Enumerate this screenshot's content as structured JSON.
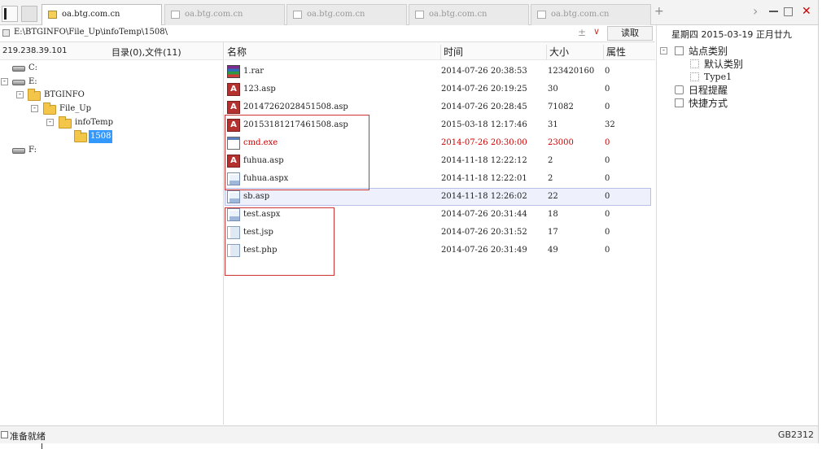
{
  "tabs": [
    {
      "label": "oa.btg.com.cn",
      "active": true
    },
    {
      "label": "oa.btg.com.cn",
      "active": false
    },
    {
      "label": "oa.btg.com.cn",
      "active": false
    },
    {
      "label": "oa.btg.com.cn",
      "active": false
    },
    {
      "label": "oa.btg.com.cn",
      "active": false
    }
  ],
  "tabstrip": {
    "new_tab": "+",
    "scroll_right": "›",
    "maximize": "□",
    "close": "✕"
  },
  "address": {
    "path": "E:\\BTGINFO\\File_Up\\infoTemp\\1508\\",
    "add_label": "±",
    "dropdown": "∨",
    "read_button": "读取"
  },
  "date_panel": {
    "text": "星期四 2015-03-19 正月廿九"
  },
  "left": {
    "server_ip": "219.238.39.101",
    "dir_summary": "目录(0),文件(11)",
    "tree": [
      {
        "label": "C:",
        "type": "drive",
        "expander": ""
      },
      {
        "label": "E:",
        "type": "drive",
        "expander": "-"
      },
      {
        "label": "BTGINFO",
        "type": "folder",
        "expander": "-"
      },
      {
        "label": "File_Up",
        "type": "folder",
        "expander": "-"
      },
      {
        "label": "infoTemp",
        "type": "folder",
        "expander": "-"
      },
      {
        "label": "1508",
        "type": "folder",
        "expander": "",
        "selected": true
      },
      {
        "label": "F:",
        "type": "drive",
        "expander": ""
      }
    ]
  },
  "files": {
    "columns": {
      "name": "名称",
      "time": "时间",
      "size": "大小",
      "attr": "属性"
    },
    "rows": [
      {
        "name": "1.rar",
        "time": "2014-07-26 20:38:53",
        "size": "123420160",
        "attr": "0",
        "icon": "rar-icon"
      },
      {
        "name": "123.asp",
        "time": "2014-07-26 20:19:25",
        "size": "30",
        "attr": "0",
        "icon": "asp-icon"
      },
      {
        "name": "20147262028451508.asp",
        "time": "2014-07-26 20:28:45",
        "size": "71082",
        "attr": "0",
        "icon": "asp-icon"
      },
      {
        "name": "20153181217461508.asp",
        "time": "2015-03-18 12:17:46",
        "size": "31",
        "attr": "32",
        "icon": "asp-icon"
      },
      {
        "name": "cmd.exe",
        "time": "2014-07-26 20:30:00",
        "size": "23000",
        "attr": "0",
        "icon": "exe-icon",
        "highlight": "red"
      },
      {
        "name": "fuhua.asp",
        "time": "2014-11-18 12:22:12",
        "size": "2",
        "attr": "0",
        "icon": "asp-icon"
      },
      {
        "name": "fuhua.aspx",
        "time": "2014-11-18 12:22:01",
        "size": "2",
        "attr": "0",
        "icon": "aspx-icon"
      },
      {
        "name": "sb.asp",
        "time": "2014-11-18 12:26:02",
        "size": "22",
        "attr": "0",
        "icon": "aspx-icon",
        "selected": true
      },
      {
        "name": "test.aspx",
        "time": "2014-07-26 20:31:44",
        "size": "18",
        "attr": "0",
        "icon": "aspx-icon"
      },
      {
        "name": "test.jsp",
        "time": "2014-07-26 20:31:52",
        "size": "17",
        "attr": "0",
        "icon": "file-icon"
      },
      {
        "name": "test.php",
        "time": "2014-07-26 20:31:49",
        "size": "49",
        "attr": "0",
        "icon": "file-icon"
      }
    ]
  },
  "right": {
    "items": [
      {
        "label": "站点类别",
        "expander": "-"
      },
      {
        "label": "默认类别",
        "expander": ""
      },
      {
        "label": "Type1",
        "expander": ""
      },
      {
        "label": "日程提醒",
        "expander": ""
      },
      {
        "label": "快捷方式",
        "expander": ""
      }
    ]
  },
  "status": {
    "text": "准备就绪",
    "encoding": "GB2312"
  },
  "colors": {
    "selection": "#3399ff",
    "highlight_red": "#cc0000",
    "annotation_box": "#cc3333"
  }
}
